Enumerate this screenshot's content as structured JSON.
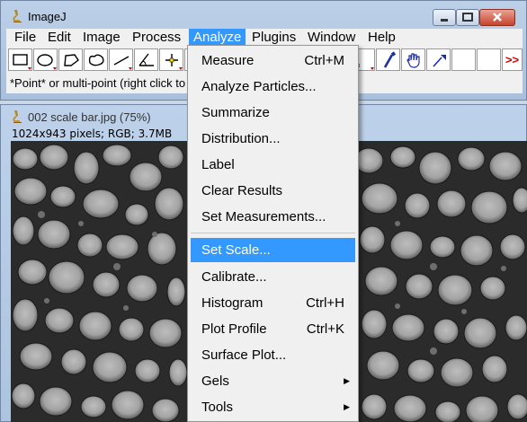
{
  "app": {
    "title": "ImageJ"
  },
  "menubar": {
    "items": [
      {
        "id": "file",
        "label": "File"
      },
      {
        "id": "edit",
        "label": "Edit"
      },
      {
        "id": "image",
        "label": "Image"
      },
      {
        "id": "process",
        "label": "Process"
      },
      {
        "id": "analyze",
        "label": "Analyze"
      },
      {
        "id": "plugins",
        "label": "Plugins"
      },
      {
        "id": "window",
        "label": "Window"
      },
      {
        "id": "help",
        "label": "Help"
      }
    ],
    "active": "Analyze"
  },
  "toolbar": {
    "tools": [
      "rectangle-tool-icon",
      "oval-tool-icon",
      "polygon-tool-icon",
      "freehand-tool-icon",
      "line-tool-icon",
      "angle-tool-icon",
      "point-tool-icon",
      "wand-tool-icon",
      "dropper-tool-icon",
      "magnifier-tool-icon"
    ],
    "more_label": ">>"
  },
  "status": {
    "text": "*Point* or multi-point (right click to"
  },
  "image_window": {
    "title": "002 scale bar.jpg (75%)",
    "info": "1024x943 pixels; RGB; 3.7MB"
  },
  "analyze_menu": {
    "items": [
      {
        "label": "Measure",
        "shortcut": "Ctrl+M"
      },
      {
        "label": "Analyze Particles...",
        "shortcut": ""
      },
      {
        "label": "Summarize",
        "shortcut": ""
      },
      {
        "label": "Distribution...",
        "shortcut": ""
      },
      {
        "label": "Label",
        "shortcut": ""
      },
      {
        "label": "Clear Results",
        "shortcut": ""
      },
      {
        "label": "Set Measurements...",
        "shortcut": ""
      },
      {
        "label": "Set Scale...",
        "shortcut": "",
        "selected": true
      },
      {
        "label": "Calibrate...",
        "shortcut": ""
      },
      {
        "label": "Histogram",
        "shortcut": "Ctrl+H"
      },
      {
        "label": "Plot Profile",
        "shortcut": "Ctrl+K"
      },
      {
        "label": "Surface Plot...",
        "shortcut": ""
      },
      {
        "label": "Gels",
        "shortcut": "",
        "submenu": true
      },
      {
        "label": "Tools",
        "shortcut": "",
        "submenu": true
      }
    ]
  },
  "colors": {
    "highlight": "#3399ff",
    "menu_bg": "#f0f0f0",
    "chrome": "#b5c9e3"
  }
}
